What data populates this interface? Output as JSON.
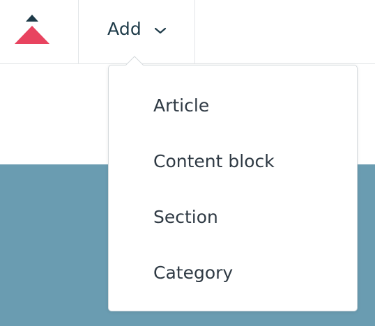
{
  "toolbar": {
    "logo_icon": "brand-logo-arrow-icon",
    "add_label": "Add",
    "add_chevron_icon": "chevron-down-icon"
  },
  "dropdown": {
    "items": [
      {
        "label": "Article"
      },
      {
        "label": "Content block"
      },
      {
        "label": "Section"
      },
      {
        "label": "Category"
      }
    ]
  },
  "colors": {
    "accent_red": "#e8435f",
    "logo_dark": "#1d3a48",
    "content_blue": "#6a9cb1"
  }
}
